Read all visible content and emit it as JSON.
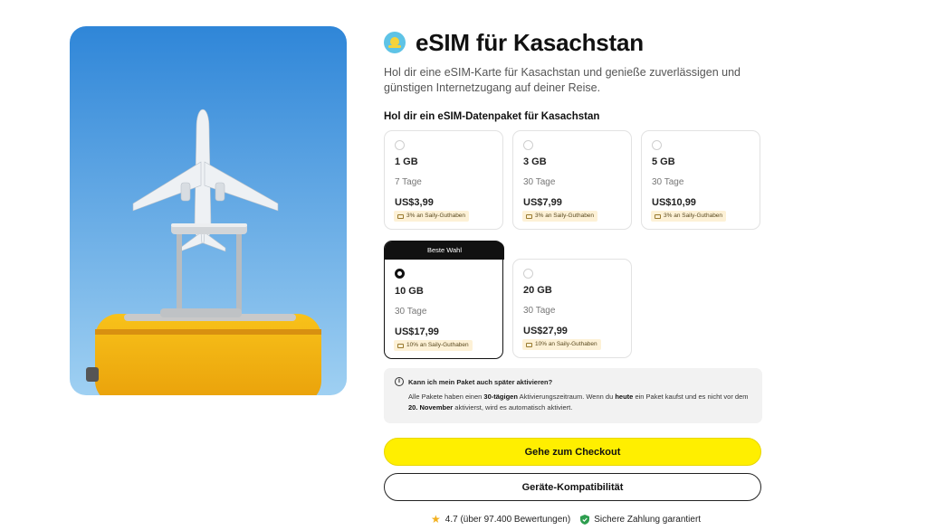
{
  "page": {
    "title": "eSIM für Kasachstan",
    "subtitle": "Hol dir eine eSIM-Karte für Kasachstan und genieße zuverlässigen und günstigen Internetzugang auf deiner Reise.",
    "section_label": "Hol dir ein eSIM-Datenpaket für Kasachstan",
    "flag_icon": "kazakhstan-flag-icon"
  },
  "plans": [
    {
      "data": "1 GB",
      "validity": "7 Tage",
      "price": "US$3,99",
      "credit": "3% an Saily-Guthaben",
      "selected": false
    },
    {
      "data": "3 GB",
      "validity": "30 Tage",
      "price": "US$7,99",
      "credit": "3% an Saily-Guthaben",
      "selected": false
    },
    {
      "data": "5 GB",
      "validity": "30 Tage",
      "price": "US$10,99",
      "credit": "3% an Saily-Guthaben",
      "selected": false
    },
    {
      "data": "10 GB",
      "validity": "30 Tage",
      "price": "US$17,99",
      "credit": "10% an Saily-Guthaben",
      "selected": true,
      "badge": "Beste Wahl"
    },
    {
      "data": "20 GB",
      "validity": "30 Tage",
      "price": "US$27,99",
      "credit": "10% an Saily-Guthaben",
      "selected": false
    }
  ],
  "info": {
    "question": "Kann ich mein Paket auch später aktivieren?",
    "answer_p1": "Alle Pakete haben einen ",
    "answer_b1": "30-tägigen",
    "answer_p2": " Aktivierungszeitraum. Wenn du ",
    "answer_b2": "heute",
    "answer_p3": " ein Paket kaufst und es nicht vor dem ",
    "answer_b3": "20. November",
    "answer_p4": " aktivierst, wird es automatisch aktiviert."
  },
  "buttons": {
    "checkout": "Gehe zum Checkout",
    "compatibility": "Geräte-Kompatibilität"
  },
  "trust": {
    "rating": "4.7 (über 97.400 Bewertungen)",
    "payment": "Sichere Zahlung garantiert"
  },
  "colors": {
    "accent_yellow": "#ffef00",
    "credit_bg": "#fdf1d6",
    "shield_green": "#2e9e4f",
    "star": "#f2b01e"
  }
}
